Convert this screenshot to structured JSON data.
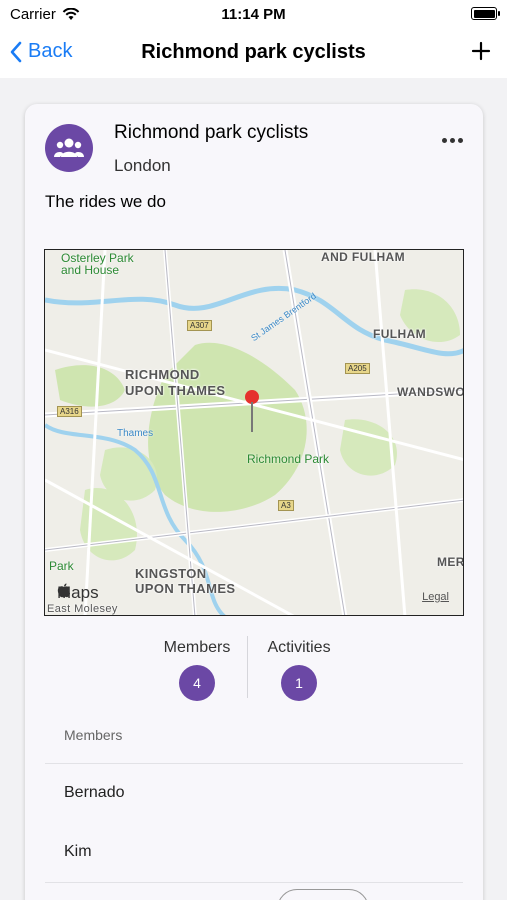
{
  "status_bar": {
    "carrier": "Carrier",
    "time": "11:14 PM"
  },
  "nav": {
    "back_label": "Back",
    "title": "Richmond park cyclists"
  },
  "group": {
    "name": "Richmond park cyclists",
    "location": "London",
    "section_title": "The rides we do"
  },
  "map": {
    "labels": {
      "osterley": "Osterley Park\nand House",
      "fulham1": "AND FULHAM",
      "fulham2": "FULHAM",
      "richmond": "RICHMOND\nUPON THAMES",
      "wandsworth": "WANDSWO",
      "richmond_park": "Richmond Park",
      "kingston": "KINGSTON\nUPON THAMES",
      "park": "Park",
      "east_molesey": "East Molesey",
      "mer": "MER",
      "thames": "Thames",
      "thames_river": "St James Brentford",
      "a307": "A307",
      "a205": "A205",
      "a316": "A316",
      "a3": "A3",
      "maps_logo": "Maps",
      "legal": "Legal"
    }
  },
  "stats": {
    "members_label": "Members",
    "members_count": "4",
    "activities_label": "Activities",
    "activities_count": "1"
  },
  "members": {
    "header": "Members",
    "list": [
      "Bernado",
      "Kim"
    ]
  },
  "colors": {
    "accent": "#6b48a5",
    "link": "#1a7cf5"
  }
}
